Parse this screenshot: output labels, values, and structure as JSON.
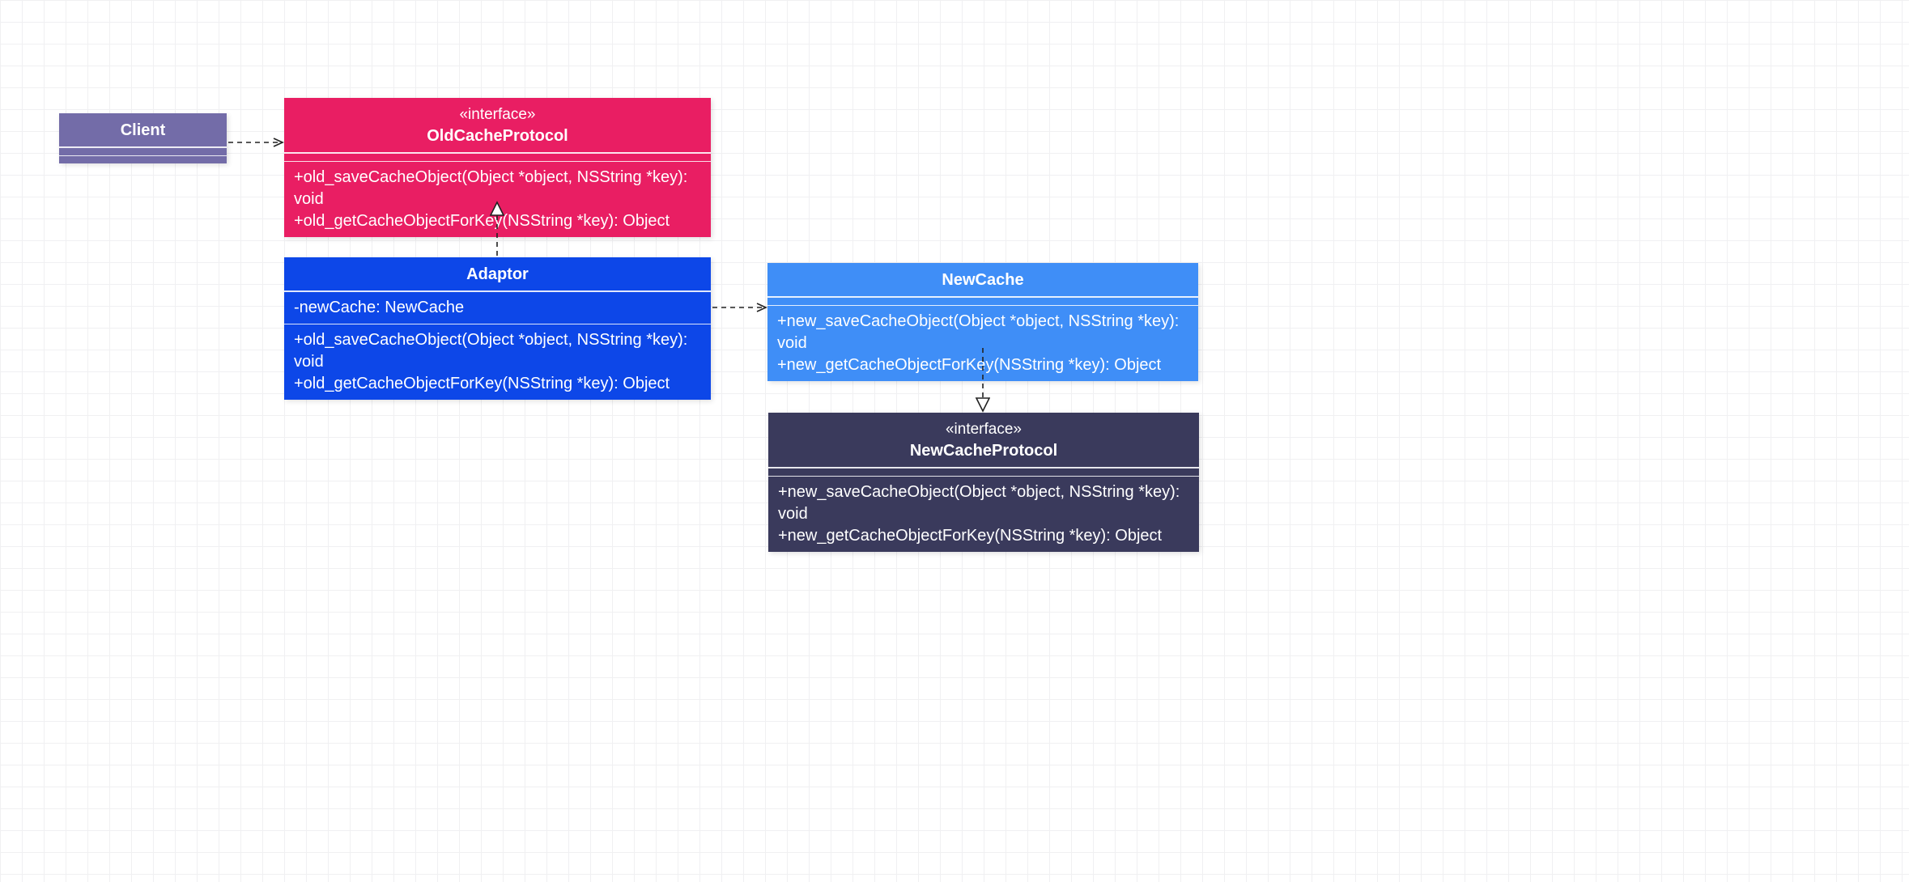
{
  "client": {
    "name": "Client"
  },
  "oldCacheProtocol": {
    "stereotype": "«interface»",
    "name": "OldCacheProtocol",
    "methods": [
      "+old_saveCacheObject(Object *object, NSString *key): void",
      "+old_getCacheObjectForKey(NSString *key): Object"
    ]
  },
  "adaptor": {
    "name": "Adaptor",
    "attributes": [
      "-newCache: NewCache"
    ],
    "methods": [
      "+old_saveCacheObject(Object *object, NSString *key): void",
      "+old_getCacheObjectForKey(NSString *key): Object"
    ]
  },
  "newCache": {
    "name": "NewCache",
    "methods": [
      "+new_saveCacheObject(Object *object, NSString *key): void",
      "+new_getCacheObjectForKey(NSString *key): Object"
    ]
  },
  "newCacheProtocol": {
    "stereotype": "«interface»",
    "name": "NewCacheProtocol",
    "methods": [
      "+new_saveCacheObject(Object *object, NSString *key): void",
      "+new_getCacheObjectForKey(NSString *key): Object"
    ]
  }
}
